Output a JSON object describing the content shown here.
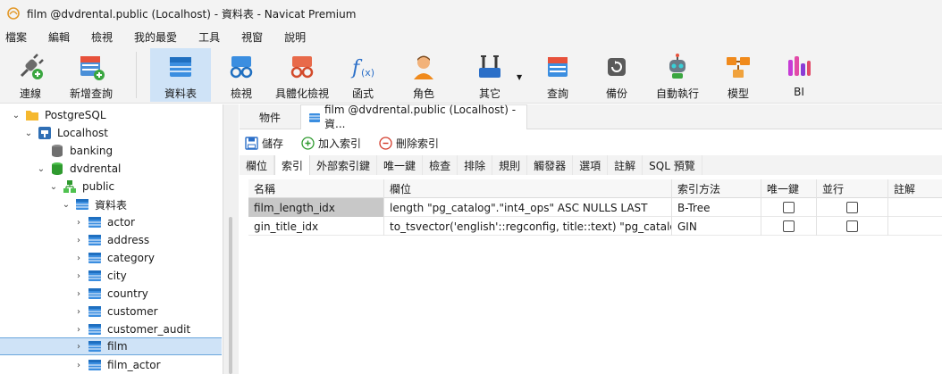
{
  "window": {
    "title": "film @dvdrental.public (Localhost) - 資料表 - Navicat Premium"
  },
  "menu": [
    "檔案",
    "編輯",
    "檢視",
    "我的最愛",
    "工具",
    "視窗",
    "說明"
  ],
  "toolbar": [
    {
      "label": "連線",
      "icon": "plug-icon"
    },
    {
      "label": "新增查詢",
      "icon": "new-query-icon"
    },
    {
      "label": "資料表",
      "icon": "table-icon",
      "active": true
    },
    {
      "label": "檢視",
      "icon": "view-glasses-icon"
    },
    {
      "label": "具體化檢視",
      "icon": "materialized-view-icon"
    },
    {
      "label": "函式",
      "icon": "function-icon"
    },
    {
      "label": "角色",
      "icon": "user-role-icon"
    },
    {
      "label": "其它",
      "icon": "tools-icon"
    },
    {
      "label": "查詢",
      "icon": "query-icon"
    },
    {
      "label": "備份",
      "icon": "backup-icon"
    },
    {
      "label": "自動執行",
      "icon": "robot-icon"
    },
    {
      "label": "模型",
      "icon": "model-icon"
    },
    {
      "label": "BI",
      "icon": "bi-chart-icon"
    }
  ],
  "tree": [
    {
      "label": "PostgreSQL",
      "level": 0,
      "expanded": true,
      "icon": "folder-icon"
    },
    {
      "label": "Localhost",
      "level": 1,
      "expanded": true,
      "icon": "postgres-elephant-icon"
    },
    {
      "label": "banking",
      "level": 2,
      "icon": "database-icon"
    },
    {
      "label": "dvdrental",
      "level": 2,
      "expanded": true,
      "icon": "database-icon"
    },
    {
      "label": "public",
      "level": 3,
      "expanded": true,
      "icon": "schema-icon"
    },
    {
      "label": "資料表",
      "level": 4,
      "expanded": true,
      "icon": "table-icon"
    },
    {
      "label": "actor",
      "level": 5,
      "icon": "table-icon"
    },
    {
      "label": "address",
      "level": 5,
      "icon": "table-icon"
    },
    {
      "label": "category",
      "level": 5,
      "icon": "table-icon"
    },
    {
      "label": "city",
      "level": 5,
      "icon": "table-icon"
    },
    {
      "label": "country",
      "level": 5,
      "icon": "table-icon"
    },
    {
      "label": "customer",
      "level": 5,
      "icon": "table-icon"
    },
    {
      "label": "customer_audit",
      "level": 5,
      "icon": "table-icon"
    },
    {
      "label": "film",
      "level": 5,
      "icon": "table-icon",
      "selected": true
    },
    {
      "label": "film_actor",
      "level": 5,
      "icon": "table-icon"
    }
  ],
  "doc_tabs": [
    {
      "label": "物件"
    },
    {
      "label": "film @dvdrental.public (Localhost) - 資...",
      "active": true
    }
  ],
  "actions": {
    "save": "儲存",
    "add_index": "加入索引",
    "delete_index": "刪除索引"
  },
  "sub_tabs": [
    "欄位",
    "索引",
    "外部索引鍵",
    "唯一鍵",
    "檢查",
    "排除",
    "規則",
    "觸發器",
    "選項",
    "註解",
    "SQL 預覽"
  ],
  "grid": {
    "headers": {
      "name": "名稱",
      "field": "欄位",
      "method": "索引方法",
      "unique": "唯一鍵",
      "concurrent": "並行",
      "comment": "註解"
    },
    "rows": [
      {
        "name": "film_length_idx",
        "field": "length \"pg_catalog\".\"int4_ops\" ASC NULLS LAST",
        "method": "B-Tree",
        "unique": false,
        "concurrent": false,
        "selected": true
      },
      {
        "name": "gin_title_idx",
        "field": "to_tsvector('english'::regconfig, title::text) \"pg_catalog\".\"tsv",
        "method": "GIN",
        "unique": false,
        "concurrent": false
      }
    ]
  }
}
